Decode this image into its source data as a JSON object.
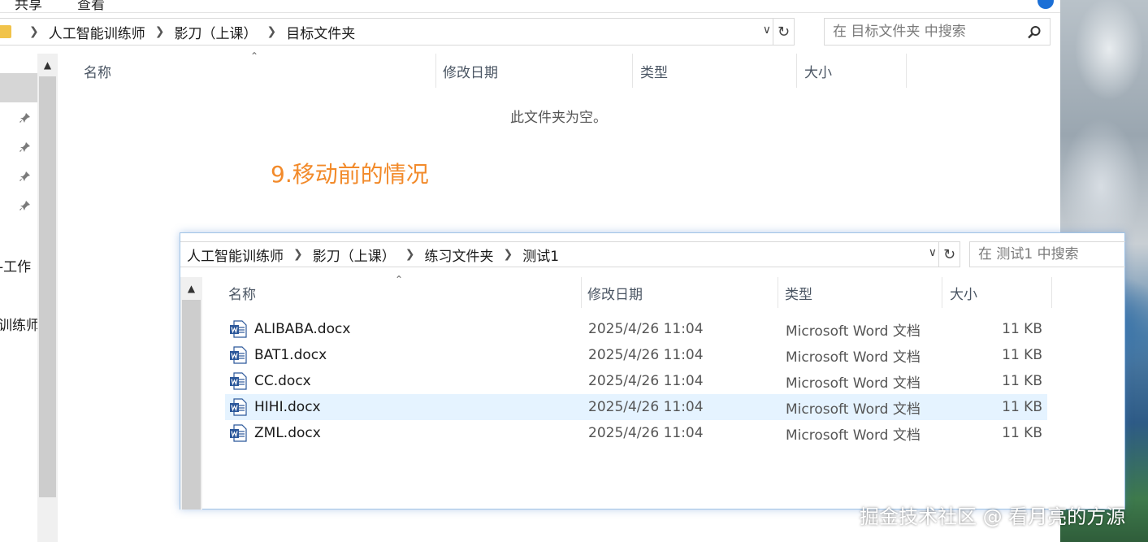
{
  "back_window": {
    "menu": {
      "item1": "共享",
      "item2": "查看"
    },
    "breadcrumb": [
      "人工智能训练师",
      "影刀（上课）",
      "目标文件夹"
    ],
    "search_placeholder": "在 目标文件夹 中搜索",
    "nav_fragments": [
      "-工作",
      "训练师"
    ],
    "columns": {
      "name": "名称",
      "date": "修改日期",
      "type": "类型",
      "size": "大小"
    },
    "empty_message": "此文件夹为空。"
  },
  "annotation": "9.移动前的情况",
  "front_window": {
    "breadcrumb": [
      "人工智能训练师",
      "影刀（上课）",
      "练习文件夹",
      "测试1"
    ],
    "search_placeholder": "在 测试1 中搜索",
    "columns": {
      "name": "名称",
      "date": "修改日期",
      "type": "类型",
      "size": "大小"
    },
    "files": [
      {
        "name": "ALIBABA.docx",
        "date": "2025/4/26 11:04",
        "type": "Microsoft Word 文档",
        "size": "11 KB",
        "selected": false
      },
      {
        "name": "BAT1.docx",
        "date": "2025/4/26 11:04",
        "type": "Microsoft Word 文档",
        "size": "11 KB",
        "selected": false
      },
      {
        "name": "CC.docx",
        "date": "2025/4/26 11:04",
        "type": "Microsoft Word 文档",
        "size": "11 KB",
        "selected": false
      },
      {
        "name": "HIHI.docx",
        "date": "2025/4/26 11:04",
        "type": "Microsoft Word 文档",
        "size": "11 KB",
        "selected": true
      },
      {
        "name": "ZML.docx",
        "date": "2025/4/26 11:04",
        "type": "Microsoft Word 文档",
        "size": "11 KB",
        "selected": false
      }
    ]
  },
  "watermark": "掘金技术社区 @ 看月亮的方源",
  "colors": {
    "accent": "#1b6fd6",
    "annotation": "#f28a2a",
    "selection": "#e5f3ff",
    "word_blue": "#2b579a"
  }
}
